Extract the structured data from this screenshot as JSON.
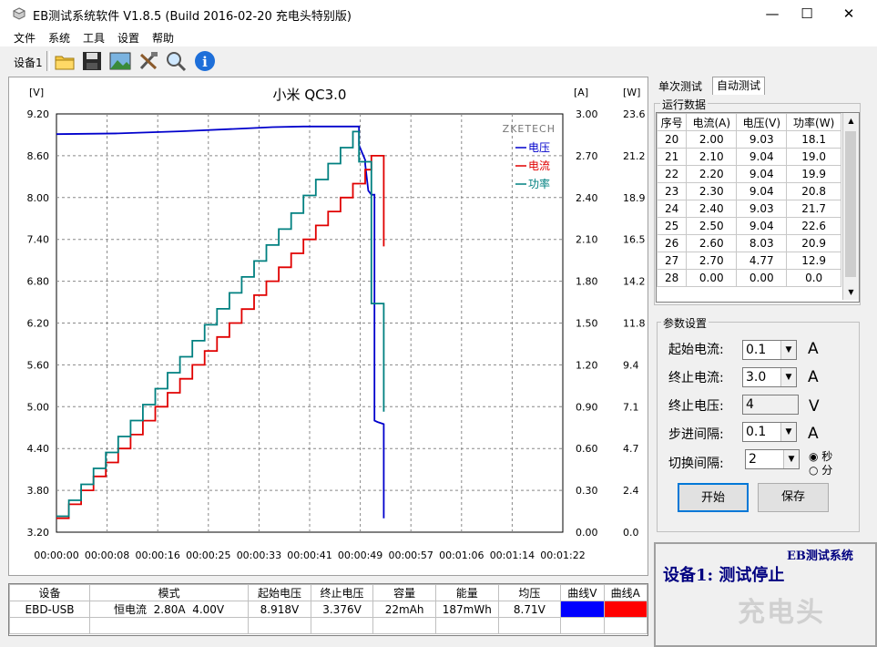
{
  "window": {
    "title": "EB测试系统软件 V1.8.5 (Build 2016-02-20 充电头特别版)",
    "minimize": "—",
    "maximize": "☐",
    "close": "✕"
  },
  "menu": [
    "文件",
    "系统",
    "工具",
    "设置",
    "帮助"
  ],
  "toolbar": {
    "device_label": "设备1",
    "icons": [
      "open-folder-icon",
      "save-disk-icon",
      "image-icon",
      "tools-icon",
      "magnifier-icon",
      "info-icon"
    ]
  },
  "chart_data": {
    "type": "line",
    "title": "小米 QC3.0",
    "watermark": "ZKETECH",
    "left_unit": "[V]",
    "right_unit_1": "[A]",
    "right_unit_2": "[W]",
    "y_left_ticks": [
      "9.20",
      "8.60",
      "8.00",
      "7.40",
      "6.80",
      "6.20",
      "5.60",
      "5.00",
      "4.40",
      "3.80",
      "3.20"
    ],
    "y_right1_ticks": [
      "3.00",
      "2.70",
      "2.40",
      "2.10",
      "1.80",
      "1.50",
      "1.20",
      "0.90",
      "0.60",
      "0.30",
      "0.00"
    ],
    "y_right2_ticks": [
      "23.6",
      "21.2",
      "18.9",
      "16.5",
      "14.2",
      "11.8",
      "9.4",
      "7.1",
      "4.7",
      "2.4",
      "0.0"
    ],
    "x_ticks": [
      "00:00:00",
      "00:00:08",
      "00:00:16",
      "00:00:25",
      "00:00:33",
      "00:00:41",
      "00:00:49",
      "00:00:57",
      "00:01:06",
      "00:01:14",
      "00:01:22"
    ],
    "ylim_voltage": [
      3.2,
      9.2
    ],
    "ylim_current": [
      0,
      3.0
    ],
    "ylim_power": [
      0,
      23.6
    ],
    "xlim_seconds": [
      0,
      82
    ],
    "legend_position": "top-right",
    "series": [
      {
        "name": "电压",
        "color": "#0000cc",
        "points": [
          [
            0,
            8.91
          ],
          [
            10,
            8.92
          ],
          [
            20,
            8.95
          ],
          [
            30,
            8.99
          ],
          [
            35,
            9.01
          ],
          [
            40,
            9.02
          ],
          [
            49,
            9.02
          ],
          [
            49,
            8.75
          ],
          [
            50,
            8.54
          ],
          [
            50,
            8.48
          ],
          [
            50.5,
            8.1
          ],
          [
            51,
            8.04
          ],
          [
            51.5,
            8.04
          ],
          [
            51.5,
            4.8
          ],
          [
            52,
            4.78
          ],
          [
            53,
            4.75
          ],
          [
            53,
            4.76
          ],
          [
            53,
            3.4
          ]
        ]
      },
      {
        "name": "电流",
        "color": "#e00000",
        "points": [
          [
            0,
            0.1
          ],
          [
            2,
            0.1
          ],
          [
            2,
            0.2
          ],
          [
            4,
            0.2
          ],
          [
            4,
            0.3
          ],
          [
            6,
            0.3
          ],
          [
            6,
            0.4
          ],
          [
            8,
            0.4
          ],
          [
            8,
            0.5
          ],
          [
            10,
            0.5
          ],
          [
            10,
            0.6
          ],
          [
            12,
            0.6
          ],
          [
            12,
            0.7
          ],
          [
            14,
            0.7
          ],
          [
            14,
            0.8
          ],
          [
            16,
            0.8
          ],
          [
            16,
            0.9
          ],
          [
            18,
            0.9
          ],
          [
            18,
            1.0
          ],
          [
            20,
            1.0
          ],
          [
            20,
            1.1
          ],
          [
            22,
            1.1
          ],
          [
            22,
            1.2
          ],
          [
            24,
            1.2
          ],
          [
            24,
            1.3
          ],
          [
            26,
            1.3
          ],
          [
            26,
            1.4
          ],
          [
            28,
            1.4
          ],
          [
            28,
            1.5
          ],
          [
            30,
            1.5
          ],
          [
            30,
            1.6
          ],
          [
            32,
            1.6
          ],
          [
            32,
            1.7
          ],
          [
            34,
            1.7
          ],
          [
            34,
            1.8
          ],
          [
            36,
            1.8
          ],
          [
            36,
            1.9
          ],
          [
            38,
            1.9
          ],
          [
            38,
            2.0
          ],
          [
            40,
            2.0
          ],
          [
            40,
            2.1
          ],
          [
            42,
            2.1
          ],
          [
            42,
            2.2
          ],
          [
            44,
            2.2
          ],
          [
            44,
            2.3
          ],
          [
            46,
            2.3
          ],
          [
            46,
            2.4
          ],
          [
            48,
            2.4
          ],
          [
            48,
            2.5
          ],
          [
            50,
            2.5
          ],
          [
            50,
            2.6
          ],
          [
            51,
            2.6
          ],
          [
            51,
            2.7
          ],
          [
            53,
            2.7
          ],
          [
            53,
            2.6
          ],
          [
            53,
            2.05
          ]
        ]
      },
      {
        "name": "功率",
        "color": "#008080",
        "points": [
          [
            0,
            0.9
          ],
          [
            2,
            0.9
          ],
          [
            2,
            1.8
          ],
          [
            4,
            1.8
          ],
          [
            4,
            2.7
          ],
          [
            6,
            2.7
          ],
          [
            6,
            3.6
          ],
          [
            8,
            3.6
          ],
          [
            8,
            4.5
          ],
          [
            10,
            4.5
          ],
          [
            10,
            5.4
          ],
          [
            12,
            5.4
          ],
          [
            12,
            6.3
          ],
          [
            14,
            6.3
          ],
          [
            14,
            7.2
          ],
          [
            16,
            7.2
          ],
          [
            16,
            8.1
          ],
          [
            18,
            8.1
          ],
          [
            18,
            9.0
          ],
          [
            20,
            9.0
          ],
          [
            20,
            9.9
          ],
          [
            22,
            9.9
          ],
          [
            22,
            10.8
          ],
          [
            24,
            10.8
          ],
          [
            24,
            11.7
          ],
          [
            26,
            11.7
          ],
          [
            26,
            12.6
          ],
          [
            28,
            12.6
          ],
          [
            28,
            13.5
          ],
          [
            30,
            13.5
          ],
          [
            30,
            14.4
          ],
          [
            32,
            14.4
          ],
          [
            32,
            15.3
          ],
          [
            34,
            15.3
          ],
          [
            34,
            16.2
          ],
          [
            36,
            16.2
          ],
          [
            36,
            17.1
          ],
          [
            38,
            17.1
          ],
          [
            38,
            18.0
          ],
          [
            40,
            18.0
          ],
          [
            40,
            19.0
          ],
          [
            42,
            19.0
          ],
          [
            42,
            19.9
          ],
          [
            44,
            19.9
          ],
          [
            44,
            20.8
          ],
          [
            46,
            20.8
          ],
          [
            46,
            21.7
          ],
          [
            48,
            21.7
          ],
          [
            48,
            22.6
          ],
          [
            49,
            22.6
          ],
          [
            49,
            20.9
          ],
          [
            50,
            20.9
          ],
          [
            50,
            20.9
          ],
          [
            51,
            20.9
          ],
          [
            51,
            12.9
          ],
          [
            51.5,
            12.9
          ],
          [
            51.5,
            12.9
          ],
          [
            53,
            12.9
          ],
          [
            53,
            6.8
          ]
        ]
      }
    ]
  },
  "summary_table": {
    "headers": [
      "设备",
      "模式",
      "起始电压",
      "终止电压",
      "容量",
      "能量",
      "均压",
      "曲线V",
      "曲线A"
    ],
    "row": [
      "EBD-USB",
      "恒电流  2.80A  4.00V",
      "8.918V",
      "3.376V",
      "22mAh",
      "187mWh",
      "8.71V"
    ],
    "curve_v_color": "#0000ff",
    "curve_a_color": "#ff0000"
  },
  "tabs": [
    "单次测试",
    "自动测试"
  ],
  "run_data": {
    "label": "运行数据",
    "headers": [
      "序号",
      "电流(A)",
      "电压(V)",
      "功率(W)"
    ],
    "rows": [
      [
        "20",
        "2.00",
        "9.03",
        "18.1"
      ],
      [
        "21",
        "2.10",
        "9.04",
        "19.0"
      ],
      [
        "22",
        "2.20",
        "9.04",
        "19.9"
      ],
      [
        "23",
        "2.30",
        "9.04",
        "20.8"
      ],
      [
        "24",
        "2.40",
        "9.03",
        "21.7"
      ],
      [
        "25",
        "2.50",
        "9.04",
        "22.6"
      ],
      [
        "26",
        "2.60",
        "8.03",
        "20.9"
      ],
      [
        "27",
        "2.70",
        "4.77",
        "12.9"
      ],
      [
        "28",
        "0.00",
        "0.00",
        "0.0"
      ]
    ]
  },
  "params": {
    "label": "参数设置",
    "start_current_label": "起始电流:",
    "start_current": "0.1",
    "start_current_unit": "A",
    "end_current_label": "终止电流:",
    "end_current": "3.0",
    "end_current_unit": "A",
    "end_voltage_label": "终止电压:",
    "end_voltage": "4",
    "end_voltage_unit": "V",
    "step_label": "步进间隔:",
    "step": "0.1",
    "step_unit": "A",
    "switch_label": "切换间隔:",
    "switch": "2",
    "unit_sec": "秒",
    "unit_min": "分",
    "start_btn": "开始",
    "save_btn": "保存"
  },
  "status": {
    "header": "EB测试系统",
    "message": "设备1: 测试停止"
  }
}
